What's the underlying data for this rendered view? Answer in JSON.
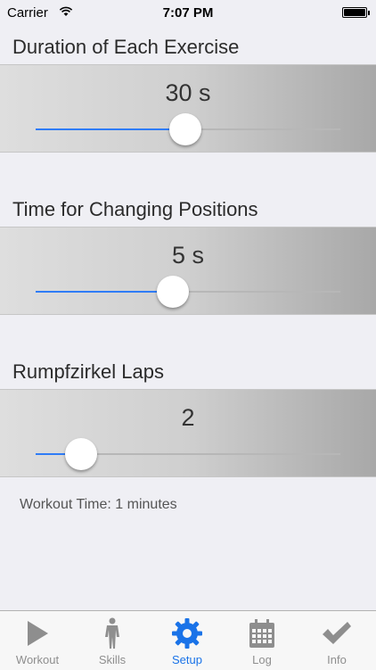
{
  "status_bar": {
    "carrier": "Carrier",
    "time": "7:07 PM"
  },
  "sections": [
    {
      "title": "Duration of Each Exercise",
      "value": "30 s",
      "slider_fraction": 0.49
    },
    {
      "title": "Time for Changing Positions",
      "value": "5 s",
      "slider_fraction": 0.45
    },
    {
      "title": "Rumpfzirkel Laps",
      "value": "2",
      "slider_fraction": 0.15
    }
  ],
  "workout_time": "Workout Time: 1 minutes",
  "tabs": [
    {
      "label": "Workout",
      "icon": "play-icon",
      "active": false
    },
    {
      "label": "Skills",
      "icon": "person-icon",
      "active": false
    },
    {
      "label": "Setup",
      "icon": "gear-icon",
      "active": true
    },
    {
      "label": "Log",
      "icon": "calendar-icon",
      "active": false
    },
    {
      "label": "Info",
      "icon": "checkmark-icon",
      "active": false
    }
  ],
  "colors": {
    "accent": "#1a73e8",
    "slider_fill": "#2f7cf6",
    "background": "#efeff4"
  }
}
